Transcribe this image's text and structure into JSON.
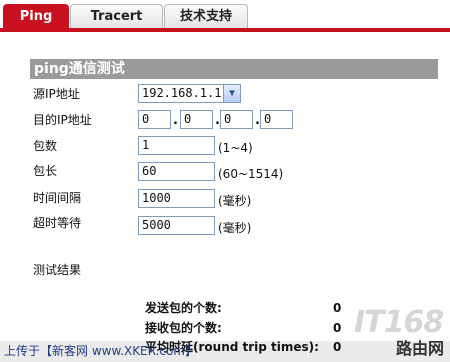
{
  "tabs": [
    {
      "label": "Ping",
      "active": true
    },
    {
      "label": "Tracert",
      "active": false
    },
    {
      "label": "技术支持",
      "active": false
    }
  ],
  "section": {
    "title": "ping通信测试"
  },
  "form": {
    "source_ip": {
      "label": "源IP地址",
      "value": "192.168.1.1"
    },
    "dest_ip": {
      "label": "目的IP地址",
      "octets": [
        "0",
        "0",
        "0",
        "0"
      ],
      "separator": "."
    },
    "packet_count": {
      "label": "包数",
      "value": "1",
      "hint": "(1~4)"
    },
    "packet_size": {
      "label": "包长",
      "value": "60",
      "hint": "(60~1514)"
    },
    "interval": {
      "label": "时间间隔",
      "value": "1000",
      "hint": "(毫秒)"
    },
    "timeout": {
      "label": "超时等待",
      "value": "5000",
      "hint": "(毫秒)"
    }
  },
  "results": {
    "title": "测试结果",
    "sent": {
      "label": "发送包的个数:",
      "value": "0"
    },
    "received": {
      "label": "接收包的个数:",
      "value": "0"
    },
    "rtt": {
      "label": "平均时延(round trip times):",
      "value": "0"
    }
  },
  "watermark": {
    "text": "IT168"
  },
  "footer": {
    "left_text": "上传于【新客网 www.XKER.com】",
    "right_text": "路由网"
  },
  "colors": {
    "accent": "#c8101e",
    "section_bar": "#9a9a9a",
    "field_border": "#7f9db9"
  }
}
